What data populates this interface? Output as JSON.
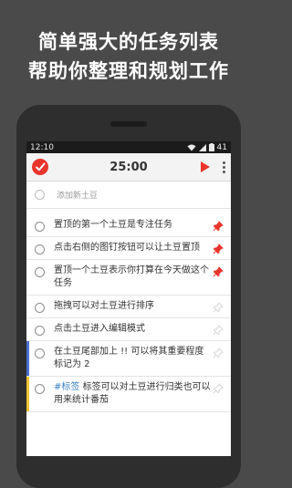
{
  "promo": {
    "line1": "简单强大的任务列表",
    "line2": "帮助你整理和规划工作"
  },
  "status_bar": {
    "time": "12:10",
    "battery": "41",
    "icons": [
      "wifi-icon",
      "signal-icon",
      "battery-icon"
    ]
  },
  "app_bar": {
    "logo": "check-logo-icon",
    "timer": "25:00",
    "play": "play-icon",
    "menu": "more-vert-icon"
  },
  "add_task": {
    "placeholder": "添加新土豆"
  },
  "tasks": [
    {
      "text": "置顶的第一个土豆是专注任务",
      "pinned": true
    },
    {
      "text": "点击右侧的图钉按钮可以让土豆置顶",
      "pinned": true
    },
    {
      "text": "置顶一个土豆表示你打算在今天做这个任务",
      "pinned": true
    },
    {
      "text": "拖拽可以对土豆进行排序",
      "pinned": false
    },
    {
      "text": "点击土豆进入编辑模式",
      "pinned": false
    },
    {
      "text": "在土豆尾部加上 !! 可以将其重要程度标记为 2",
      "pinned": false,
      "priority_color": "#4a6fd1"
    },
    {
      "tag": "#标签",
      "text": " 标签可以对土豆进行归类也可以用来统计番茄",
      "pinned": false,
      "priority_color": "#f2c230"
    }
  ],
  "colors": {
    "accent": "#e8352c",
    "pin_active": "#e8352c",
    "pin_inactive": "#cfcfcf",
    "tag": "#3b7fbf"
  }
}
